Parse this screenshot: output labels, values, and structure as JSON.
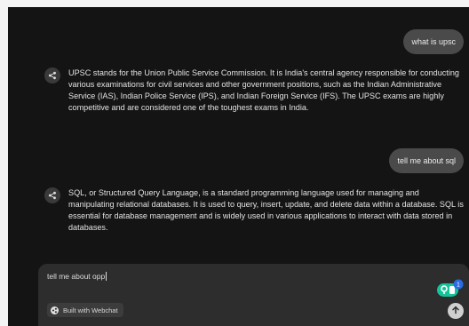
{
  "conversation": {
    "messages": [
      {
        "role": "user",
        "text": "what is upsc"
      },
      {
        "role": "assistant",
        "text": "UPSC stands for the Union Public Service Commission. It is India's central agency responsible for conducting various examinations for civil services and other government positions, such as the Indian Administrative Service (IAS), Indian Police Service (IPS), and Indian Foreign Service (IFS). The UPSC exams are highly competitive and are considered one of the toughest exams in India."
      },
      {
        "role": "user",
        "text": "tell me about sql"
      },
      {
        "role": "assistant",
        "text": "SQL, or Structured Query Language, is a standard programming language used for managing and manipulating relational databases. It is used to query, insert, update, and delete data within a database. SQL is essential for database management and is widely used in various applications to interact with data stored in databases."
      }
    ]
  },
  "composer": {
    "input_value": "tell me about opp",
    "built_with_label": "Built with Webchat",
    "grammar_badge_count": "1"
  },
  "icons": {
    "bot_avatar": "share-nodes-icon",
    "send": "arrow-up-icon",
    "built_with_logo": "webchat-logo-icon",
    "grammar": "grammar-assistant-icon"
  },
  "colors": {
    "background": "#141414",
    "user_bubble": "#4a4a4a",
    "composer": "#2d2d2d",
    "grammar_green": "#15c39a"
  }
}
